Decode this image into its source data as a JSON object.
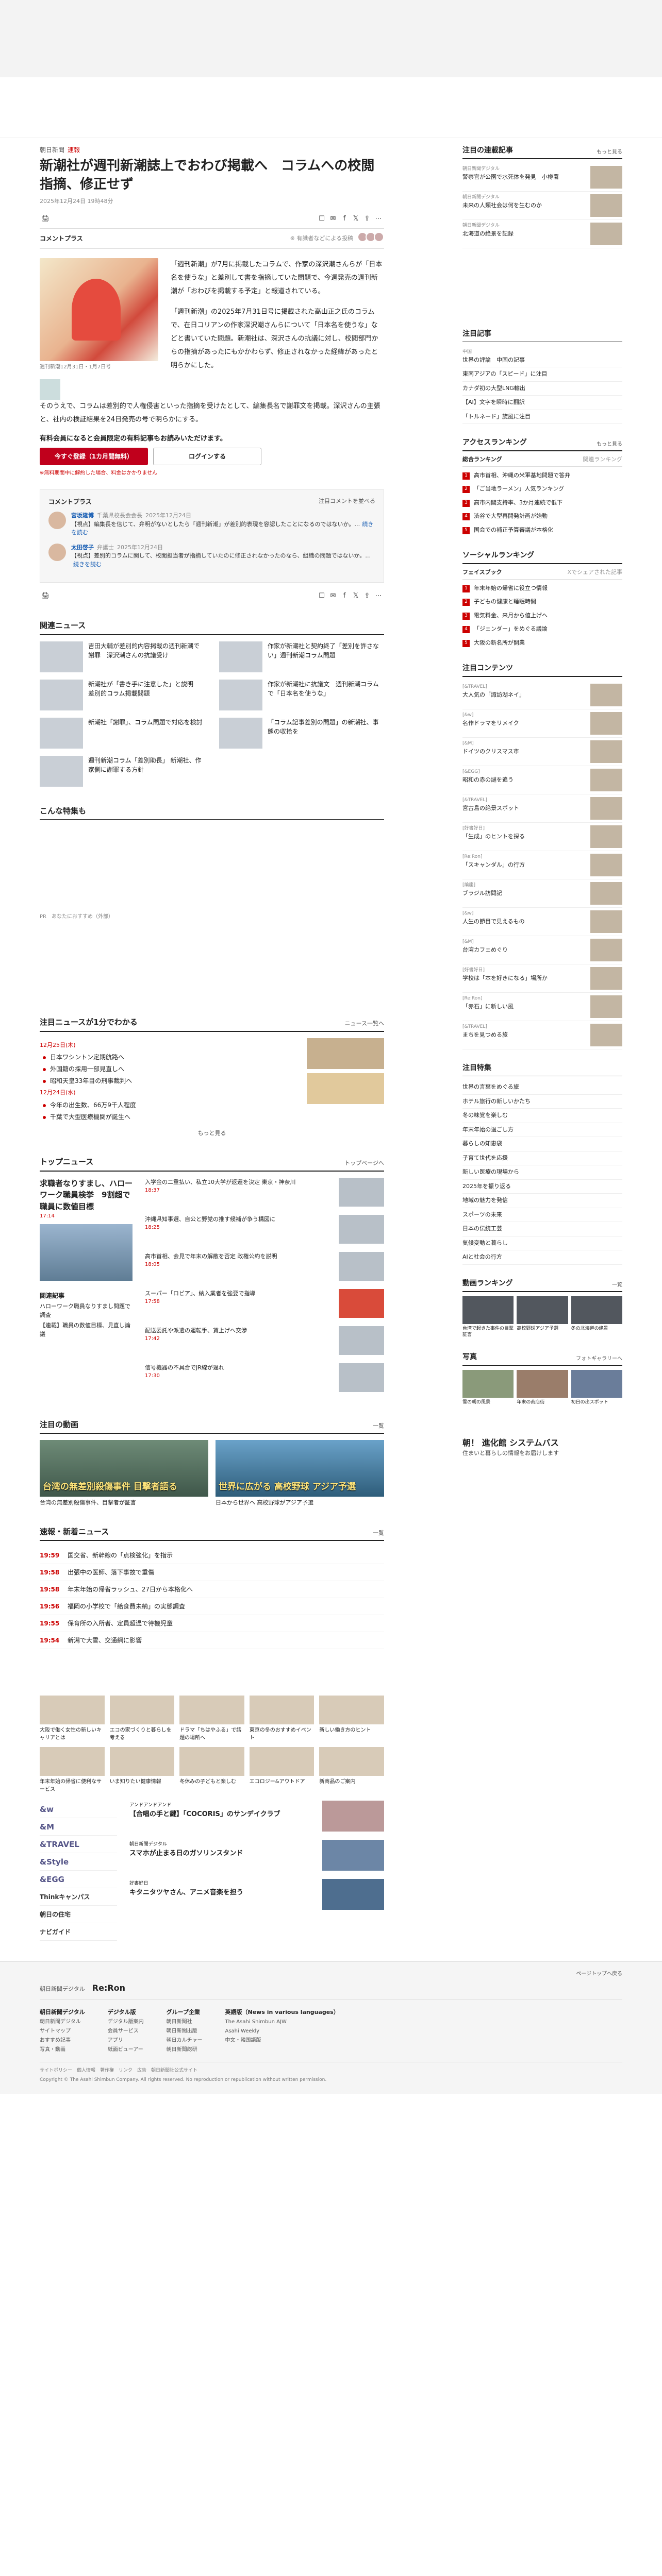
{
  "article": {
    "category": "朝日新聞",
    "category_tag": "速報",
    "title": "新潮社が週刊新潮誌上でおわび掲載へ　コラムへの校閲指摘、修正せず",
    "date": "2025年12月24日 19時48分",
    "comment_label": "コメントプラス",
    "comment_meta": "※ 有識者などによる投稿",
    "photo_caption": "週刊新潮12月31日・1月7日号",
    "body_right": [
      "「週刊新潮」が7月に掲載したコラムで、作家の深沢潮さんらが「日本名を使うな」と差別して書を指摘していた問題で、今週発売の週刊新潮が「おわびを掲載する予定」と報道されている。",
      "「週刊新潮」の2025年7月31日号に掲載された高山正之氏のコラムで、在日コリアンの作家深沢潮さんらについて「日本名を使うな」などと書いていた問題。新潮社は、深沢さんの抗議に対し、校閲部門からの指摘があったにもかかわらず、修正されなかった経緯があったと明らかにした。"
    ],
    "body_left": "そのうえで、コラムは差別的で人権侵害といった指摘を受けたとして、編集長名で謝罪文を掲載。深沢さんの主張と、社内の検証結果を24日発売の号で明らかにする。",
    "paywall_text": "有料会員になると会員限定の有料記事もお読みいただけます。",
    "subscribe_btn": "今すぐ登録（1カ月間無料）",
    "login_btn": "ログインする",
    "note": "※無料期間中に解約した場合、料金はかかりません"
  },
  "comments": {
    "header": "コメントプラス",
    "more": "注目コメントを並べる",
    "items": [
      {
        "name": "宮坂隆博",
        "role": "千葉県校長会会長",
        "date": "2025年12月24日",
        "body": "【視点】編集長を信じて、弁明がないとしたら「週刊新潮」が差別的表現を容認したことになるのではないか。…",
        "link": "続きを読む"
      },
      {
        "name": "太田啓子",
        "role": "弁護士",
        "date": "2025年12月24日",
        "body": "【視点】差別的コラムに関して、校閲担当者が指摘していたのに修正されなかったのなら、組織の問題ではないか。…",
        "link": "続きを読む"
      }
    ]
  },
  "related": {
    "title": "関連ニュース",
    "items": [
      "吉田大輔が差別的内容掲載の週刊新潮で謝罪　深沢潮さんの抗議受け",
      "作家が新潮社と契約終了「差別を許さない」週刊新潮コラム問題",
      "新潮社が「書き手に注意した」と説明　差別的コラム掲載問題",
      "作家が新潮社に抗議文　週刊新潮コラムで「日本名を使うな」",
      "新潮社「謝罪」、コラム問題で対応を検討",
      "「コラム記事差別の問題」の新潮社、事態の収拾を",
      "週刊新潮コラム「差別助長」 新潮社、作家側に謝罪する方針"
    ]
  },
  "recommend": {
    "title": "こんな特集も",
    "ad_text": "PR　あなたにおすすめ（外部）"
  },
  "timeline": {
    "title": "注目ニュースが1分でわかる",
    "more": "ニュース一覧へ",
    "dates": [
      {
        "date": "12月25日(木)",
        "items": [
          "日本ワシントン定期航路へ",
          "外国籍の採用一部見直しへ",
          "昭和天皇33年目の刑事裁判へ"
        ]
      },
      {
        "date": "12月24日(水)",
        "items": [
          "今年の出生数、66万9千人程度",
          "千葉で大型医療機関が誕生へ"
        ]
      }
    ],
    "more_btn": "もっと見る"
  },
  "topnews": {
    "title": "トップニュース",
    "more": "トップページへ",
    "lead": "求職者なりすまし、ハローワーク職員検挙　9割超で職員に数値目標",
    "lead_time": "17:14",
    "items": [
      {
        "text": "入学金の二重払い、私立10大学が返還を決定 東京・神奈川",
        "time": "18:37"
      },
      {
        "text": "沖縄県知事選、自公と野党の推す候補が争う構図に",
        "time": "18:25"
      },
      {
        "text": "高市首相、会見で年末の解散を否定 政権公約を説明",
        "time": "18:05"
      },
      {
        "text": "スーパー「ロピア」、納入業者を強要で指導",
        "time": "17:58"
      },
      {
        "text": "配送委託や派遣の運転手、賃上げへ交渉",
        "time": "17:42"
      },
      {
        "text": "信号機器の不具合でJR線が遅れ",
        "time": "17:30"
      }
    ],
    "related_title": "関連記事",
    "related": [
      "ハローワーク職員なりすまし問題で調査",
      "【連載】職員の数値目標、見直し論議"
    ]
  },
  "videos": {
    "title": "注目の動画",
    "more": "一覧",
    "items": [
      {
        "caption": "台湾の無差別殺傷事件 目撃者語る",
        "text": "台湾の無差別殺傷事件、目撃者が証言"
      },
      {
        "caption": "世界に広がる 高校野球 アジア予選",
        "text": "日本から世界へ 高校野球がアジア予選"
      }
    ]
  },
  "flash": {
    "title": "速報・新着ニュース",
    "more": "一覧",
    "items": [
      {
        "time": "19:59",
        "text": "国交省、新幹線の「点検強化」を指示"
      },
      {
        "time": "19:58",
        "text": "出張中の医師、落下事故で重傷"
      },
      {
        "time": "19:58",
        "text": "年末年始の帰省ラッシュ、27日から本格化へ"
      },
      {
        "time": "19:56",
        "text": "福岡の小学校で「給食費未納」の実態調査"
      },
      {
        "time": "19:55",
        "text": "保育所の入所者、定員超過で待機児童"
      },
      {
        "time": "19:54",
        "text": "新潟で大雪、交通網に影響"
      }
    ]
  },
  "promos": [
    {
      "text": "大阪で働く女性の新しいキャリアとは"
    },
    {
      "text": "エコの家づくりと暮らしを考える"
    },
    {
      "text": "ドラマ「ちはやふる」で話題の場所へ"
    },
    {
      "text": "東京の冬のおすすめイベント"
    },
    {
      "text": "新しい働き方のヒント"
    },
    {
      "text": "年末年始の帰省に便利なサービス"
    },
    {
      "text": "いま知りたい健康情報"
    },
    {
      "text": "冬休みの子どもと楽しむ"
    },
    {
      "text": "エコロジー&アウトドア"
    },
    {
      "text": "新商品のご案内"
    }
  ],
  "brands": {
    "list": [
      "&w",
      "&M",
      "&TRAVEL",
      "&Style",
      "&EGG"
    ],
    "items": [
      {
        "title": "【合唱の手と鍵】「COCORIS」のサンデイクラブ",
        "text": "アンドアンドアンド"
      },
      {
        "title": "スマホが止まる日のガソリンスタンド",
        "text": "朝日新聞デジタル"
      },
      {
        "title": "キタニタツヤさん、アニメ音楽を担う",
        "text": "好書好日"
      }
    ],
    "logos": [
      "Thinkキャンパス",
      "朝日の住宅",
      "ナビガイド"
    ]
  },
  "footer": {
    "site": "朝日新聞デジタル",
    "brand": "Re:Ron",
    "pagetop": "ページトップへ戻る",
    "cols": [
      {
        "head": "朝日新聞デジタル",
        "items": [
          "朝日新聞デジタル",
          "サイトマップ",
          "おすすめ記事",
          "写真・動画"
        ]
      },
      {
        "head": "デジタル版",
        "items": [
          "デジタル版案内",
          "会員サービス",
          "アプリ",
          "紙面ビューアー"
        ]
      },
      {
        "head": "グループ企業",
        "items": [
          "朝日新聞社",
          "朝日新聞出版",
          "朝日カルチャー",
          "朝日新聞総研"
        ]
      },
      {
        "head": "英語版（News in various languages）",
        "items": [
          "The Asahi Shimbun AJW",
          "Asahi Weekly",
          "中文・韓国語版"
        ]
      }
    ],
    "links": "サイトポリシー　個人情報　著作権　リンク　広告　朝日新聞社公式サイト",
    "copyright": "Copyright © The Asahi Shimbun Company. All rights reserved. No reproduction or republication without written permission."
  },
  "sidebar": {
    "recommend": {
      "title": "注目の連載記事",
      "more": "もっと見る",
      "items": [
        {
          "sub": "朝日新聞デジタル",
          "text": "警察官が公園で水死体を発見　小樽署"
        },
        {
          "sub": "朝日新聞デジタル",
          "text": "未来の人類社会は何を生むのか"
        },
        {
          "sub": "朝日新聞デジタル",
          "text": "北海道の絶景を記録"
        }
      ]
    },
    "related_title": "注目記事",
    "list": [
      {
        "sub": "中国",
        "text": "世界の評論　中国の記事"
      },
      {
        "sub": "",
        "text": "東南アジアの「スピード」に注目"
      },
      {
        "sub": "",
        "text": "カナダ初の大型LNG輸出"
      },
      {
        "sub": "",
        "text": "【AI】文字を瞬時に翻訳"
      },
      {
        "sub": "",
        "text": "「トルネード」旋風に注目"
      }
    ],
    "ranking": {
      "title": "アクセスランキング",
      "more": "もっと見る",
      "tabs": [
        "総合ランキング",
        "関連ランキング"
      ],
      "items": [
        "高市首相、沖縄の米軍基地問題で答弁",
        "「ご当地ラーメン」人気ランキング",
        "高市内閣支持率、3か月連続で低下",
        "渋谷で大型再開発計画が始動",
        "国会での補正予算審議が本格化"
      ]
    },
    "social": {
      "title": "ソーシャルランキング",
      "more": "",
      "tabs": [
        "フェイスブック",
        "Xでシェアされた記事"
      ],
      "items": [
        "年末年始の帰省に役立つ情報",
        "子どもの健康と睡眠時間",
        "電気料金、来月から値上げへ",
        "「ジェンダー」をめぐる議論",
        "大阪の新名所が開業"
      ]
    },
    "features": {
      "title": "注目コンテンツ",
      "items": [
        {
          "sub": "[&TRAVEL]",
          "text": "大人気の「諏訪湖ネイ」"
        },
        {
          "sub": "[&w]",
          "text": "名作ドラマをリメイク"
        },
        {
          "sub": "[&M]",
          "text": "ドイツのクリスマス市"
        },
        {
          "sub": "[&EGG]",
          "text": "昭和の赤の謎を追う"
        },
        {
          "sub": "[&TRAVEL]",
          "text": "宮古島の絶景スポット"
        },
        {
          "sub": "[好書好日]",
          "text": "「生成」のヒントを探る"
        },
        {
          "sub": "[Re:Ron]",
          "text": "「スキャンダル」の行方"
        },
        {
          "sub": "[論座]",
          "text": "ブラジル訪問記"
        },
        {
          "sub": "[&w]",
          "text": "人生の節目で見えるもの"
        },
        {
          "sub": "[&M]",
          "text": "台湾カフェめぐり"
        },
        {
          "sub": "[好書好日]",
          "text": "学校は「本を好きになる」場所か"
        },
        {
          "sub": "[Re:Ron]",
          "text": "「赤石」に新しい風"
        },
        {
          "sub": "[&TRAVEL]",
          "text": "まちを見つめる旅"
        }
      ]
    },
    "ranks2": {
      "title": "注目特集",
      "items": [
        "世界の言葉をめぐる旅",
        "ホテル旅行の新しいかたち",
        "冬の味覚を楽しむ",
        "年末年始の過ごし方",
        "暮らしの知恵袋",
        "子育て世代を応援",
        "新しい医療の現場から",
        "2025年を振り返る",
        "地域の魅力を発信",
        "スポーツの未来",
        "日本の伝統工芸",
        "気候変動と暮らし",
        "AIと社会の行方"
      ]
    },
    "videos": {
      "title": "動画ランキング",
      "more": "一覧",
      "items": [
        "台湾で起きた事件の目撃証言",
        "高校野球アジア予選",
        "冬の北海道の絶景"
      ]
    },
    "photos": {
      "title": "写真",
      "more": "フォトギャラリーへ",
      "items": [
        "雪の朝の風景",
        "年末の商店街",
        "初日の出スポット"
      ]
    },
    "ad": {
      "title": "朝！ 進化館 システムバス",
      "text": "住まいと暮らしの情報をお届けします"
    }
  }
}
